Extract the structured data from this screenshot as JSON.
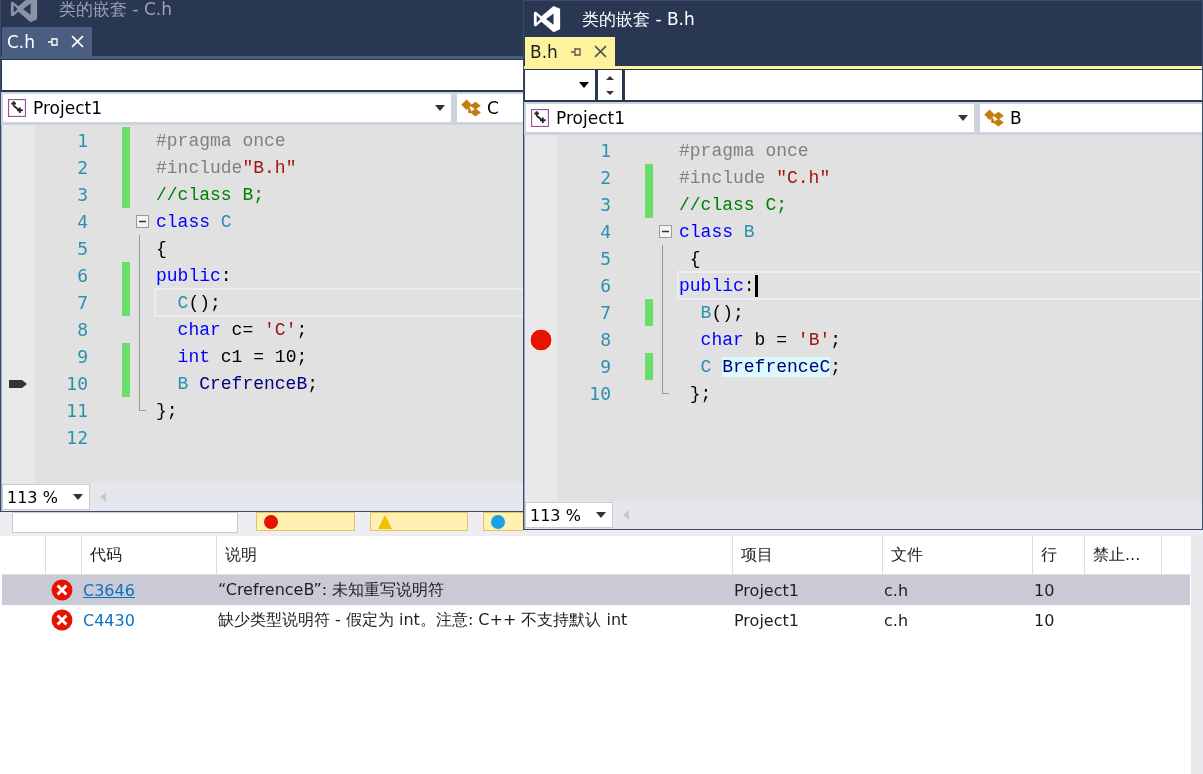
{
  "windows": [
    {
      "title": "类的嵌套 - C.h",
      "active": false,
      "tab": {
        "label": "C.h",
        "selected": false
      },
      "toolbar": {
        "kind": "blank"
      },
      "nav": {
        "project": "Project1",
        "scope": "C"
      },
      "zoom": "113 %",
      "lines": [
        {
          "number": "1",
          "changed": true,
          "current": false,
          "kind": "plain",
          "tokens": [
            {
              "text": "#pragma once",
              "kind": "pre"
            }
          ]
        },
        {
          "number": "2",
          "changed": true,
          "current": false,
          "kind": "plain",
          "tokens": [
            {
              "text": "#include",
              "kind": "pre"
            },
            {
              "text": "\"B.h\"",
              "kind": "str"
            }
          ]
        },
        {
          "number": "3",
          "changed": true,
          "current": false,
          "kind": "plain",
          "tokens": [
            {
              "text": "//class B;",
              "kind": "comment"
            }
          ]
        },
        {
          "number": "4",
          "changed": false,
          "current": false,
          "kind": "fold_start",
          "tokens": [
            {
              "text": "class",
              "kind": "kw"
            },
            {
              "text": " C",
              "kind": "type"
            }
          ]
        },
        {
          "number": "5",
          "changed": false,
          "current": false,
          "kind": "fold_body",
          "tokens": [
            {
              "text": "{",
              "kind": "plain"
            }
          ]
        },
        {
          "number": "6",
          "changed": true,
          "current": false,
          "kind": "fold_body",
          "tokens": [
            {
              "text": "public",
              "kind": "kw"
            },
            {
              "text": ":",
              "kind": "plain"
            }
          ]
        },
        {
          "number": "7",
          "changed": true,
          "current": true,
          "kind": "fold_body",
          "tokens": [
            {
              "text": "  C",
              "kind": "type"
            },
            {
              "text": "();",
              "kind": "plain"
            }
          ]
        },
        {
          "number": "8",
          "changed": false,
          "current": false,
          "kind": "fold_body",
          "tokens": [
            {
              "text": "  char",
              "kind": "kw"
            },
            {
              "text": " c= ",
              "kind": "plain"
            },
            {
              "text": "'C'",
              "kind": "str"
            },
            {
              "text": ";",
              "kind": "plain"
            }
          ]
        },
        {
          "number": "9",
          "changed": true,
          "current": false,
          "kind": "fold_body",
          "tokens": [
            {
              "text": "  int",
              "kind": "kw"
            },
            {
              "text": " c1 = 10;",
              "kind": "plain"
            }
          ]
        },
        {
          "number": "10",
          "changed": true,
          "current": false,
          "kind": "fold_body",
          "marker": {
            "kind": "arrow"
          },
          "tokens": [
            {
              "text": "  B",
              "kind": "type"
            },
            {
              "text": " CrefrenceB",
              "kind": "ident"
            },
            {
              "text": ";",
              "kind": "plain"
            }
          ]
        },
        {
          "number": "11",
          "changed": false,
          "current": false,
          "kind": "fold_end",
          "tokens": [
            {
              "text": "};",
              "kind": "plain"
            }
          ]
        },
        {
          "number": "12",
          "changed": false,
          "current": false,
          "kind": "plain"
        }
      ]
    },
    {
      "title": "类的嵌套 - B.h",
      "active": true,
      "tab": {
        "label": "B.h",
        "selected": true
      },
      "toolbar": {
        "kind": "dropdown"
      },
      "nav": {
        "project": "Project1",
        "scope": "B"
      },
      "zoom": "113 %",
      "lines": [
        {
          "number": "1",
          "changed": false,
          "current": false,
          "kind": "plain",
          "tokens": [
            {
              "text": "#pragma once",
              "kind": "pre"
            }
          ]
        },
        {
          "number": "2",
          "changed": true,
          "current": false,
          "kind": "plain",
          "tokens": [
            {
              "text": "#include ",
              "kind": "pre"
            },
            {
              "text": "\"C.h\"",
              "kind": "str"
            }
          ]
        },
        {
          "number": "3",
          "changed": true,
          "current": false,
          "kind": "plain",
          "tokens": [
            {
              "text": "//class C;",
              "kind": "comment"
            }
          ]
        },
        {
          "number": "4",
          "changed": false,
          "current": false,
          "kind": "fold_start",
          "tokens": [
            {
              "text": "class",
              "kind": "kw"
            },
            {
              "text": " B",
              "kind": "type"
            }
          ]
        },
        {
          "number": "5",
          "changed": false,
          "current": false,
          "kind": "fold_body",
          "tokens": [
            {
              "text": " {",
              "kind": "plain"
            }
          ]
        },
        {
          "number": "6",
          "changed": false,
          "current": true,
          "kind": "fold_body",
          "tokens": [
            {
              "text": "public",
              "kind": "kw"
            },
            {
              "text": ":",
              "kind": "plain"
            }
          ]
        },
        {
          "number": "7",
          "changed": true,
          "current": false,
          "kind": "fold_body",
          "tokens": [
            {
              "text": "  B",
              "kind": "type"
            },
            {
              "text": "();",
              "kind": "plain"
            }
          ]
        },
        {
          "number": "8",
          "changed": false,
          "current": false,
          "kind": "fold_body",
          "marker": {
            "kind": "breakpoint"
          },
          "tokens": [
            {
              "text": "  char",
              "kind": "kw"
            },
            {
              "text": " b = ",
              "kind": "plain"
            },
            {
              "text": "'B'",
              "kind": "str"
            },
            {
              "text": ";",
              "kind": "plain"
            }
          ]
        },
        {
          "number": "9",
          "changed": true,
          "current": false,
          "kind": "fold_body",
          "tokens": [
            {
              "text": "  C ",
              "kind": "type"
            },
            {
              "text": "BrefrenceC",
              "kind": "highlight"
            },
            {
              "text": ";",
              "kind": "plain"
            }
          ]
        },
        {
          "number": "10",
          "changed": false,
          "current": false,
          "kind": "fold_end",
          "tokens": [
            {
              "text": " };",
              "kind": "plain"
            }
          ]
        }
      ]
    }
  ],
  "error_list": {
    "columns": [
      "代码",
      "说明",
      "项目",
      "文件",
      "行",
      "禁止..."
    ],
    "rows": [
      {
        "selected": true,
        "code": "C3646",
        "description": "“CrefrenceB”: 未知重写说明符",
        "project": "Project1",
        "file": "c.h",
        "line": "10"
      },
      {
        "selected": false,
        "code": "C4430",
        "description": "缺少类型说明符 - 假定为 int。注意: C++ 不支持默认 int",
        "project": "Project1",
        "file": "c.h",
        "line": "10"
      }
    ]
  }
}
